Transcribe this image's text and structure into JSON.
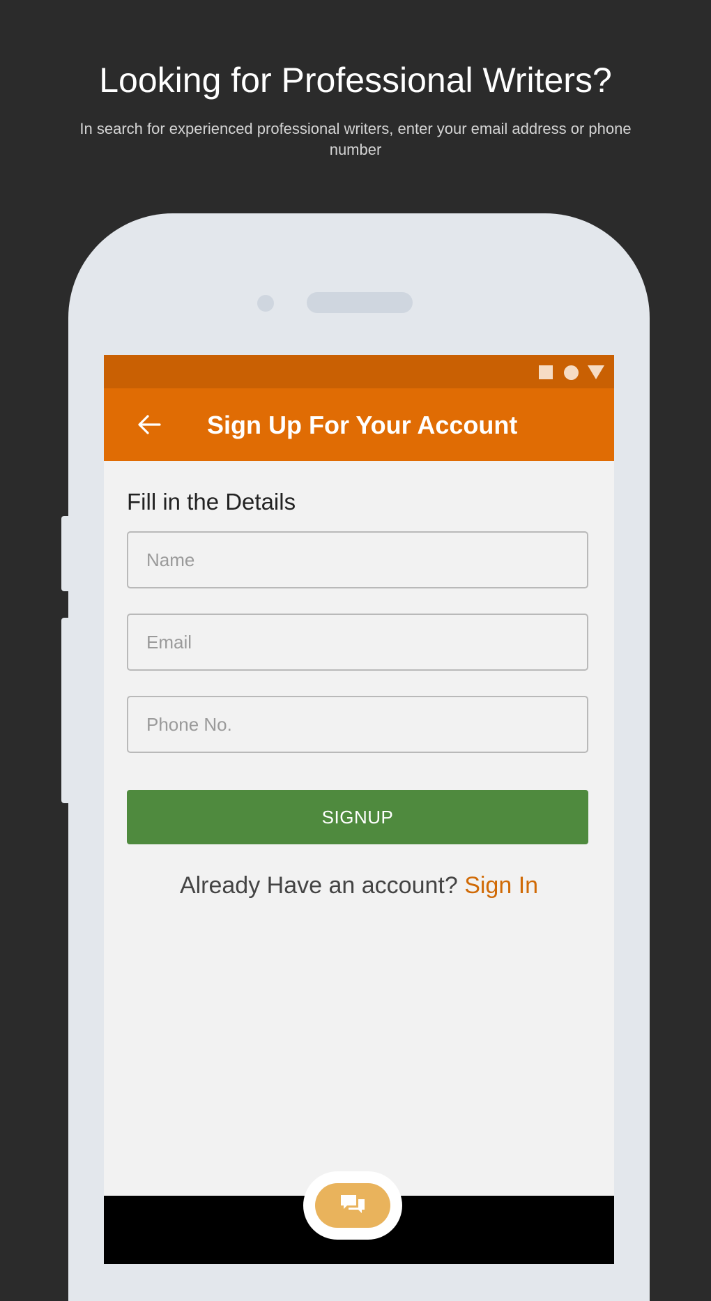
{
  "promo": {
    "title": "Looking for Professional Writers?",
    "subtitle": "In search for experienced professional writers, enter your email address or phone number"
  },
  "status_bar": {
    "icons": [
      "square-icon",
      "circle-icon",
      "triangle-icon"
    ]
  },
  "app_bar": {
    "back_icon": "back-arrow-icon",
    "title": "Sign Up For Your Account"
  },
  "form": {
    "heading": "Fill in the Details",
    "fields": {
      "name": {
        "placeholder": "Name",
        "value": ""
      },
      "email": {
        "placeholder": "Email",
        "value": ""
      },
      "phone": {
        "placeholder": "Phone No.",
        "value": ""
      }
    },
    "signup_label": "SIGNUP",
    "already_text": "Already Have an account?",
    "signin_label": "Sign In"
  },
  "chat": {
    "icon": "chat-bubbles-icon"
  },
  "colors": {
    "status_bar": "#c96003",
    "app_bar": "#e06c04",
    "signup_button": "#4f8a3e",
    "signin_link": "#d06a06",
    "chat_button": "#e9b35c",
    "background": "#2b2b2b",
    "phone_frame": "#e3e7ec"
  }
}
